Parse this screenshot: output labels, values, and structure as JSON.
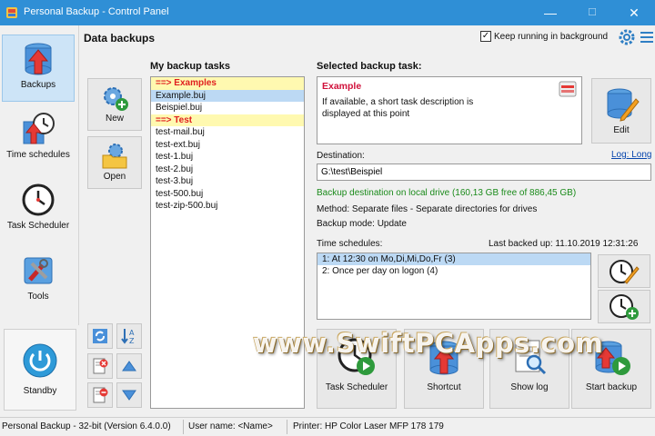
{
  "window": {
    "title": "Personal Backup - Control Panel",
    "controls": {
      "minimize": "—",
      "maximize": "☐",
      "close": "✕"
    }
  },
  "nav": {
    "items": [
      {
        "label": "Backups",
        "icon": "database-up-arrow-icon",
        "selected": true
      },
      {
        "label": "Time schedules",
        "icon": "clock-arrow-icon",
        "selected": false
      },
      {
        "label": "Task Scheduler",
        "icon": "clock-icon",
        "selected": false
      },
      {
        "label": "Tools",
        "icon": "tools-icon",
        "selected": false
      }
    ],
    "standby": {
      "label": "Standby",
      "icon": "power-icon"
    }
  },
  "header": {
    "title": "Data backups",
    "keep_running": {
      "label": "Keep running in background",
      "checked": true,
      "mark": "✓"
    }
  },
  "task_buttons": {
    "new": "New",
    "open": "Open"
  },
  "tasks": {
    "label": "My backup tasks",
    "rows": [
      {
        "text": "==> Examples",
        "kind": "group"
      },
      {
        "text": "Example.buj",
        "kind": "selected"
      },
      {
        "text": "Beispiel.buj",
        "kind": "item"
      },
      {
        "text": "==> Test",
        "kind": "group"
      },
      {
        "text": "test-mail.buj",
        "kind": "item"
      },
      {
        "text": "test-ext.buj",
        "kind": "item"
      },
      {
        "text": "test-1.buj",
        "kind": "item"
      },
      {
        "text": "test-2.buj",
        "kind": "item"
      },
      {
        "text": "test-3.buj",
        "kind": "item"
      },
      {
        "text": "test-500.buj",
        "kind": "item"
      },
      {
        "text": "test-zip-500.buj",
        "kind": "item"
      }
    ]
  },
  "selected_task": {
    "label": "Selected backup task:",
    "name": "Example",
    "description": "If available, a short task description is displayed at this point",
    "edit_label": "Edit"
  },
  "destination": {
    "label": "Destination:",
    "log_link": "Log: Long",
    "value": "G:\\test\\Beispiel",
    "status": "Backup destination on local drive (160,13 GB free of 886,45 GB)",
    "method": "Method: Separate files - Separate directories for drives",
    "mode": "Backup mode: Update"
  },
  "schedules": {
    "label": "Time schedules:",
    "last_backed": "Last backed up: 11.10.2019 12:31:26",
    "rows": [
      {
        "text": "1: At 12:30 on Mo,Di,Mi,Do,Fr (3)",
        "selected": true
      },
      {
        "text": "2: Once per day on logon (4)",
        "selected": false
      }
    ]
  },
  "bottom_buttons": {
    "task_scheduler": "Task Scheduler",
    "shortcut": "Shortcut",
    "show_log": "Show log",
    "start_backup": "Start backup"
  },
  "watermark": "www.SwiftPCApps.com",
  "status_bar": {
    "version": "Personal Backup - 32-bit (Version 6.4.0.0)",
    "user": "User name: <Name>",
    "printer": "Printer: HP Color Laser MFP 178 179"
  },
  "colors": {
    "titlebar": "#2f8fd6",
    "group_text": "#e02020",
    "group_bg": "#fff9b0",
    "selection": "#bcd9f4",
    "ok_text": "#1a8a1a",
    "link": "#0645ad"
  }
}
